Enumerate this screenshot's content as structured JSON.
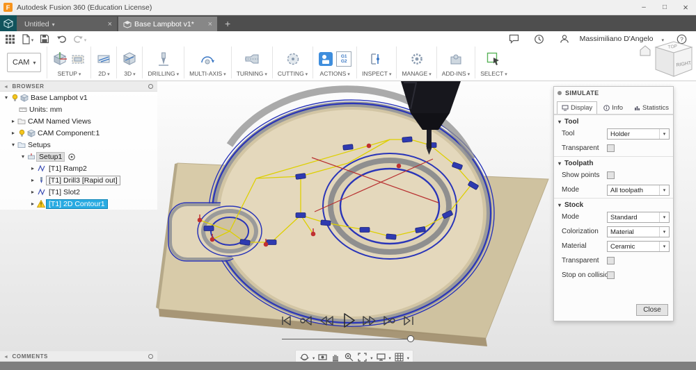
{
  "window": {
    "title": "Autodesk Fusion 360 (Education License)"
  },
  "tabs": {
    "untitled": "Untitled",
    "active": "Base Lampbot v1*"
  },
  "toolbar": {
    "user": "Massimiliano D'Angelo",
    "help": "?"
  },
  "ribbon": {
    "cam": "CAM",
    "g1": "G1",
    "g2": "G2",
    "groups": [
      {
        "label": "SETUP"
      },
      {
        "label": "2D"
      },
      {
        "label": "3D"
      },
      {
        "label": "DRILLING"
      },
      {
        "label": "MULTI-AXIS"
      },
      {
        "label": "TURNING"
      },
      {
        "label": "CUTTING"
      },
      {
        "label": "ACTIONS"
      },
      {
        "label": "INSPECT"
      },
      {
        "label": "MANAGE"
      },
      {
        "label": "ADD-INS"
      },
      {
        "label": "SELECT"
      }
    ]
  },
  "browser": {
    "header": "BROWSER",
    "root": "Base Lampbot v1",
    "units": "Units: mm",
    "named_views": "CAM Named Views",
    "component": "CAM Component:1",
    "setups": "Setups",
    "setup1": "Setup1",
    "ops": [
      {
        "label": "[T1] Ramp2"
      },
      {
        "label": "[T1] Drill3 [Rapid out]"
      },
      {
        "label": "[T1] Slot2"
      },
      {
        "label": "[T1] 2D Contour1"
      }
    ]
  },
  "comments": {
    "header": "COMMENTS"
  },
  "simulate": {
    "title": "SIMULATE",
    "tabs": [
      {
        "label": "Display"
      },
      {
        "label": "Info"
      },
      {
        "label": "Statistics"
      }
    ],
    "tool_section": "Tool",
    "tool_label": "Tool",
    "tool_value": "Holder",
    "tool_transparent": "Transparent",
    "toolpath_section": "Toolpath",
    "show_points": "Show points",
    "toolpath_mode_label": "Mode",
    "toolpath_mode_value": "All toolpath",
    "stock_section": "Stock",
    "stock_mode_label": "Mode",
    "stock_mode_value": "Standard",
    "colorization_label": "Colorization",
    "colorization_value": "Material",
    "material_label": "Material",
    "material_value": "Ceramic",
    "stock_transparent": "Transparent",
    "stop_collision": "Stop on collision",
    "close": "Close"
  },
  "viewcube": {
    "top": "TOP",
    "right": "RIGHT"
  },
  "colors": {
    "fusion_orange": "#f7941e",
    "tab_dark": "#4e4e4e",
    "accent_blue": "#0696d7",
    "selection_blue": "#29abe2",
    "stock_tan": "#ddd0b4",
    "toolpath_blue": "#2a35b8",
    "toolpath_yellow": "#ddcf00",
    "rapid_red": "#c03030"
  }
}
